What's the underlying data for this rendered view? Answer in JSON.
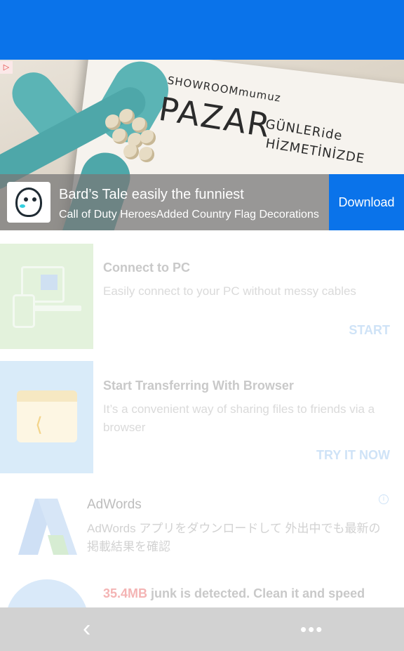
{
  "banner_ad": {
    "card_line1": "SHOWROOMmumuz",
    "card_line2": "PAZAR",
    "card_line3": "GÜNLERide",
    "card_line4": "HİZMETİNİZDE",
    "adchoices_icon": "adchoices-icon",
    "app_title": "Bard’s Tale easily the funniest",
    "app_subtitle": "Call of Duty HeroesAdded Country Flag Decorations",
    "download_label": "Download",
    "colors": {
      "download_bg": "#0a73ea",
      "topbar": "#0a73ea"
    }
  },
  "features": [
    {
      "title": "Connect to PC",
      "description": "Easily connect to your PC without messy cables",
      "action": "START",
      "icon": "pc-connect-icon"
    },
    {
      "title": "Start Transferring With Browser",
      "description": "It’s a convenient way of sharing files to friends via a browser",
      "action": "TRY IT NOW",
      "icon": "browser-share-icon"
    }
  ],
  "adwords_ad": {
    "title": "AdWords",
    "description": "AdWords アプリをダウンロードして 外出中でも最新の掲載結果を確認",
    "info_icon": "info-icon"
  },
  "junk": {
    "size": "35.4MB",
    "text": " junk is detected. Clean it and speed"
  },
  "bottom_nav": {
    "back_icon": "chevron-left-icon",
    "more_icon": "more-dots-icon"
  }
}
